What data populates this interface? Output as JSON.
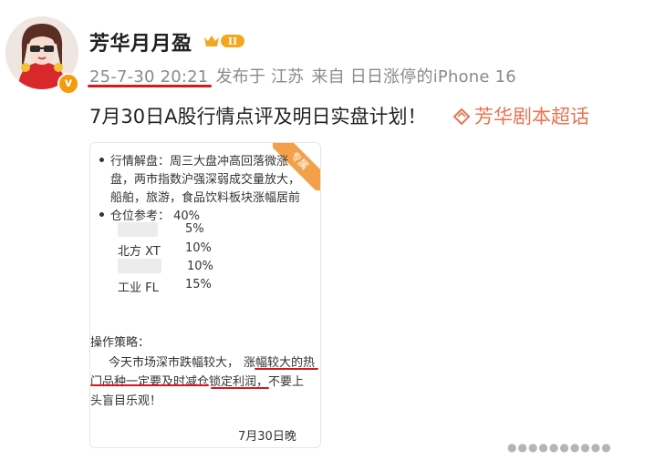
{
  "post": {
    "username": "芳华月月盈",
    "level_badge": "II",
    "verified_mark": "v",
    "timestamp": "25-7-30 20:21",
    "location": "发布于 江苏",
    "source": "来自 日日涨停的iPhone 16",
    "text": "7月30日A股行情点评及明日实盘计划！",
    "topic": "芳华剧本超话",
    "accent_color": "#eb7350",
    "highlight_color": "#d7171c"
  },
  "image": {
    "corner_tag": "专属",
    "line1": "行情解盘：周三大盘冲高回落微涨",
    "line2": "盘，两市指数沪强深弱成交量放大，",
    "line3": "船舶，旅游，食品饮料板块涨幅居前",
    "position_label": "仓位参考：  40%",
    "holdings": [
      {
        "name": "",
        "pct": "5%"
      },
      {
        "name": "北方 XT",
        "pct": "10%"
      },
      {
        "name": "",
        "pct": "10%"
      },
      {
        "name": "工业 FL",
        "pct": "15%"
      }
    ],
    "strategy_title": "操作策略：",
    "strategy_l1a": "今天市场深市跌幅较大，",
    "strategy_l1b": "涨幅较大的热",
    "strategy_l2": "门品种一定要及时减仓锁定利润，不要上",
    "strategy_l3": "头盲目乐观！",
    "date_sign": "7月30日晚"
  },
  "viewer": {
    "dots": "●●●●●●●●●●"
  }
}
